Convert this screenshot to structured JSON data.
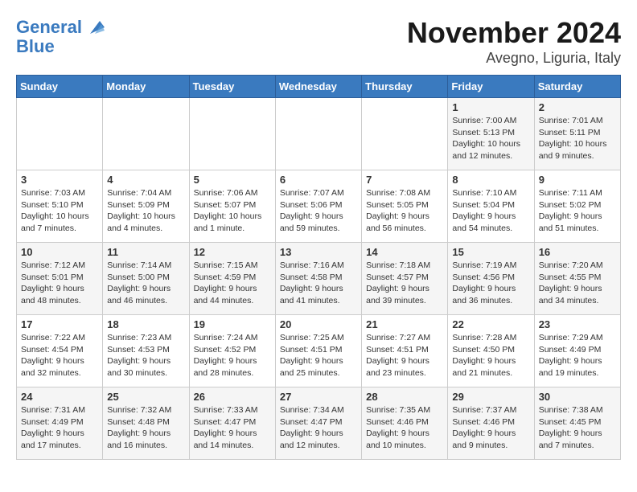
{
  "logo": {
    "line1": "General",
    "line2": "Blue"
  },
  "title": "November 2024",
  "location": "Avegno, Liguria, Italy",
  "weekdays": [
    "Sunday",
    "Monday",
    "Tuesday",
    "Wednesday",
    "Thursday",
    "Friday",
    "Saturday"
  ],
  "weeks": [
    [
      {
        "day": "",
        "info": ""
      },
      {
        "day": "",
        "info": ""
      },
      {
        "day": "",
        "info": ""
      },
      {
        "day": "",
        "info": ""
      },
      {
        "day": "",
        "info": ""
      },
      {
        "day": "1",
        "info": "Sunrise: 7:00 AM\nSunset: 5:13 PM\nDaylight: 10 hours and 12 minutes."
      },
      {
        "day": "2",
        "info": "Sunrise: 7:01 AM\nSunset: 5:11 PM\nDaylight: 10 hours and 9 minutes."
      }
    ],
    [
      {
        "day": "3",
        "info": "Sunrise: 7:03 AM\nSunset: 5:10 PM\nDaylight: 10 hours and 7 minutes."
      },
      {
        "day": "4",
        "info": "Sunrise: 7:04 AM\nSunset: 5:09 PM\nDaylight: 10 hours and 4 minutes."
      },
      {
        "day": "5",
        "info": "Sunrise: 7:06 AM\nSunset: 5:07 PM\nDaylight: 10 hours and 1 minute."
      },
      {
        "day": "6",
        "info": "Sunrise: 7:07 AM\nSunset: 5:06 PM\nDaylight: 9 hours and 59 minutes."
      },
      {
        "day": "7",
        "info": "Sunrise: 7:08 AM\nSunset: 5:05 PM\nDaylight: 9 hours and 56 minutes."
      },
      {
        "day": "8",
        "info": "Sunrise: 7:10 AM\nSunset: 5:04 PM\nDaylight: 9 hours and 54 minutes."
      },
      {
        "day": "9",
        "info": "Sunrise: 7:11 AM\nSunset: 5:02 PM\nDaylight: 9 hours and 51 minutes."
      }
    ],
    [
      {
        "day": "10",
        "info": "Sunrise: 7:12 AM\nSunset: 5:01 PM\nDaylight: 9 hours and 48 minutes."
      },
      {
        "day": "11",
        "info": "Sunrise: 7:14 AM\nSunset: 5:00 PM\nDaylight: 9 hours and 46 minutes."
      },
      {
        "day": "12",
        "info": "Sunrise: 7:15 AM\nSunset: 4:59 PM\nDaylight: 9 hours and 44 minutes."
      },
      {
        "day": "13",
        "info": "Sunrise: 7:16 AM\nSunset: 4:58 PM\nDaylight: 9 hours and 41 minutes."
      },
      {
        "day": "14",
        "info": "Sunrise: 7:18 AM\nSunset: 4:57 PM\nDaylight: 9 hours and 39 minutes."
      },
      {
        "day": "15",
        "info": "Sunrise: 7:19 AM\nSunset: 4:56 PM\nDaylight: 9 hours and 36 minutes."
      },
      {
        "day": "16",
        "info": "Sunrise: 7:20 AM\nSunset: 4:55 PM\nDaylight: 9 hours and 34 minutes."
      }
    ],
    [
      {
        "day": "17",
        "info": "Sunrise: 7:22 AM\nSunset: 4:54 PM\nDaylight: 9 hours and 32 minutes."
      },
      {
        "day": "18",
        "info": "Sunrise: 7:23 AM\nSunset: 4:53 PM\nDaylight: 9 hours and 30 minutes."
      },
      {
        "day": "19",
        "info": "Sunrise: 7:24 AM\nSunset: 4:52 PM\nDaylight: 9 hours and 28 minutes."
      },
      {
        "day": "20",
        "info": "Sunrise: 7:25 AM\nSunset: 4:51 PM\nDaylight: 9 hours and 25 minutes."
      },
      {
        "day": "21",
        "info": "Sunrise: 7:27 AM\nSunset: 4:51 PM\nDaylight: 9 hours and 23 minutes."
      },
      {
        "day": "22",
        "info": "Sunrise: 7:28 AM\nSunset: 4:50 PM\nDaylight: 9 hours and 21 minutes."
      },
      {
        "day": "23",
        "info": "Sunrise: 7:29 AM\nSunset: 4:49 PM\nDaylight: 9 hours and 19 minutes."
      }
    ],
    [
      {
        "day": "24",
        "info": "Sunrise: 7:31 AM\nSunset: 4:49 PM\nDaylight: 9 hours and 17 minutes."
      },
      {
        "day": "25",
        "info": "Sunrise: 7:32 AM\nSunset: 4:48 PM\nDaylight: 9 hours and 16 minutes."
      },
      {
        "day": "26",
        "info": "Sunrise: 7:33 AM\nSunset: 4:47 PM\nDaylight: 9 hours and 14 minutes."
      },
      {
        "day": "27",
        "info": "Sunrise: 7:34 AM\nSunset: 4:47 PM\nDaylight: 9 hours and 12 minutes."
      },
      {
        "day": "28",
        "info": "Sunrise: 7:35 AM\nSunset: 4:46 PM\nDaylight: 9 hours and 10 minutes."
      },
      {
        "day": "29",
        "info": "Sunrise: 7:37 AM\nSunset: 4:46 PM\nDaylight: 9 hours and 9 minutes."
      },
      {
        "day": "30",
        "info": "Sunrise: 7:38 AM\nSunset: 4:45 PM\nDaylight: 9 hours and 7 minutes."
      }
    ]
  ]
}
